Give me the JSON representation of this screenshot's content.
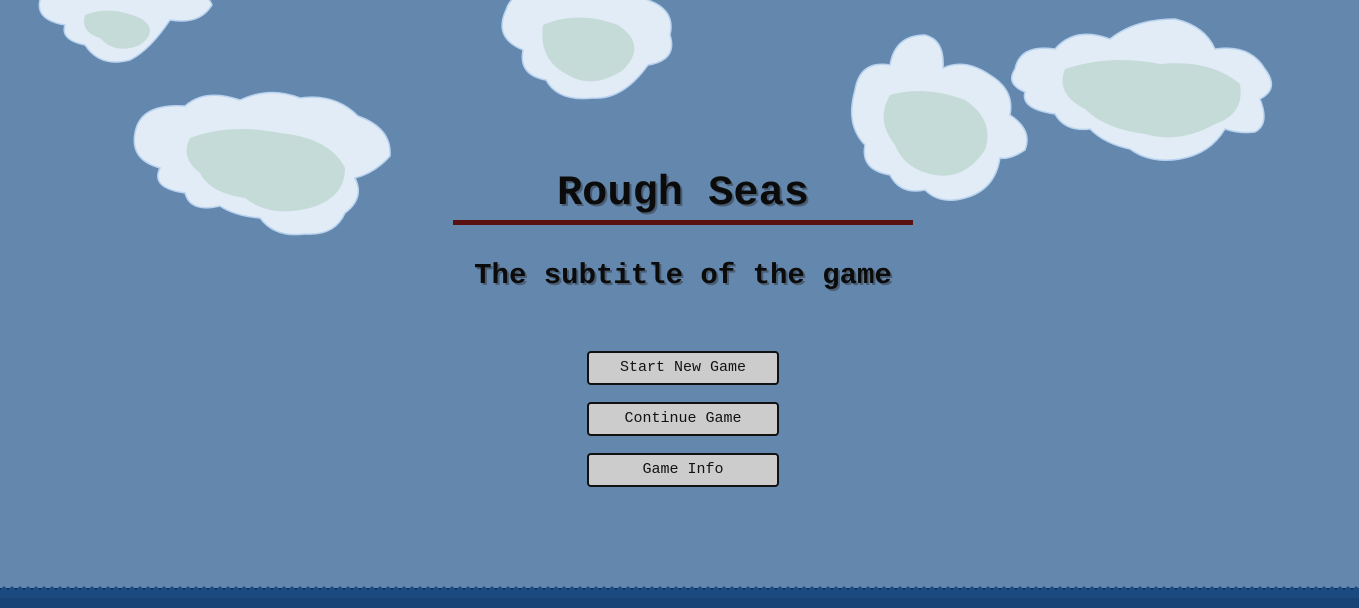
{
  "game": {
    "title": "Rough Seas",
    "subtitle": "The subtitle of the game"
  },
  "menu": {
    "items": [
      {
        "label": "Start New Game"
      },
      {
        "label": "Continue Game"
      },
      {
        "label": "Game Info"
      }
    ]
  },
  "colors": {
    "sky": "#6387ad",
    "cloud_light": "#e2ecf6",
    "cloud_shade": "#c5dbd8",
    "title_rule": "#5a0f10",
    "button_bg": "#cccccc",
    "sea": "#0d2c5a"
  }
}
